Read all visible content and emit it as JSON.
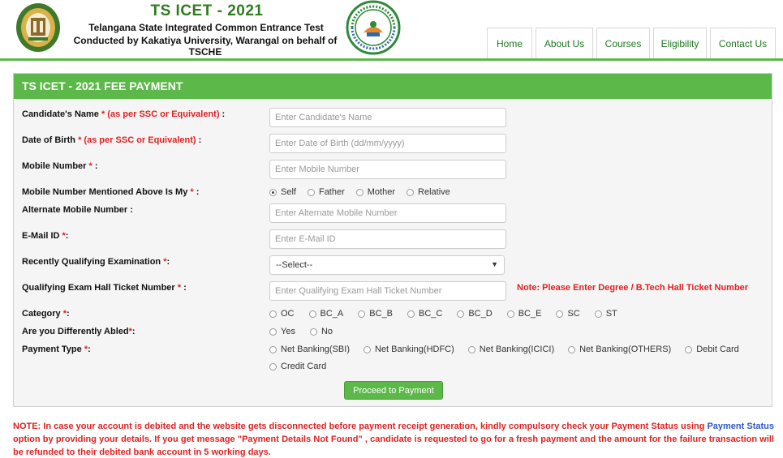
{
  "header": {
    "title": "TS ICET - 2021",
    "subtitle1": "Telangana State Integrated Common Entrance Test",
    "subtitle2": "Conducted by Kakatiya University, Warangal on behalf of TSCHE",
    "seal_text": "TELANGANA STATE COUNCIL OF HIGHER EDUCATION"
  },
  "nav": {
    "items": [
      {
        "label": "Home"
      },
      {
        "label": "About Us"
      },
      {
        "label": "Courses"
      },
      {
        "label": "Eligibility"
      },
      {
        "label": "Contact Us"
      }
    ]
  },
  "form": {
    "title": "TS ICET - 2021 FEE PAYMENT",
    "name": {
      "label": "Candidate's Name",
      "req": "* (as per SSC or Equivalent)",
      "colon": " :",
      "placeholder": "Enter Candidate's Name"
    },
    "dob": {
      "label": "Date of Birth",
      "req": "* (as per SSC or Equivalent)",
      "colon": " :",
      "placeholder": "Enter Date of Birth (dd/mm/yyyy)"
    },
    "mobile": {
      "label": "Mobile Number",
      "req": "*",
      "colon": " :",
      "placeholder": "Enter Mobile Number"
    },
    "mobile_owner": {
      "label": "Mobile Number Mentioned Above Is My",
      "req": "*",
      "colon": " :",
      "options": [
        "Self",
        "Father",
        "Mother",
        "Relative"
      ],
      "selected": "Self"
    },
    "alt_mobile": {
      "label": "Alternate Mobile Number :",
      "placeholder": "Enter Alternate Mobile Number"
    },
    "email": {
      "label": "E-Mail ID",
      "req": "*",
      "colon": ":",
      "placeholder": "Enter E-Mail ID"
    },
    "qualifying_exam": {
      "label": "Recently Qualifying Examination",
      "req": "*",
      "colon": ":",
      "selected": "--Select--"
    },
    "hall_ticket": {
      "label": "Qualifying Exam Hall Ticket Number",
      "req": "*",
      "colon": " :",
      "placeholder": "Enter Qualifying Exam Hall Ticket Number",
      "note": "Note: Please Enter Degree / B.Tech Hall Ticket Number"
    },
    "category": {
      "label": "Category",
      "req": "*",
      "colon": ":",
      "options": [
        "OC",
        "BC_A",
        "BC_B",
        "BC_C",
        "BC_D",
        "BC_E",
        "SC",
        "ST"
      ]
    },
    "disabled": {
      "label": "Are you Differently Abled",
      "req": "*",
      "colon": ":",
      "options": [
        "Yes",
        "No"
      ]
    },
    "payment_type": {
      "label": "Payment Type",
      "req": "*",
      "colon": ":",
      "options": [
        "Net Banking(SBI)",
        "Net Banking(HDFC)",
        "Net Banking(ICICI)",
        "Net Banking(OTHERS)",
        "Debit Card",
        "Credit Card"
      ]
    },
    "submit_label": "Proceed to Payment"
  },
  "bottom_note": {
    "part1": "NOTE: In case your account is debited and the website gets disconnected before payment receipt generation, kindly compulsory check your Payment Status using ",
    "link": "Payment Status",
    "part2": " option by providing your details. If you get message \"Payment Details Not Found\" , candidate is requested to go for a fresh payment and the amount for the failure transaction will be refunded to their debited bank account in 5 working days."
  },
  "colors": {
    "accent_green": "#5cb848",
    "title_green": "#2e7d1e",
    "required_red": "#e02020",
    "link_blue": "#2b56c9"
  }
}
